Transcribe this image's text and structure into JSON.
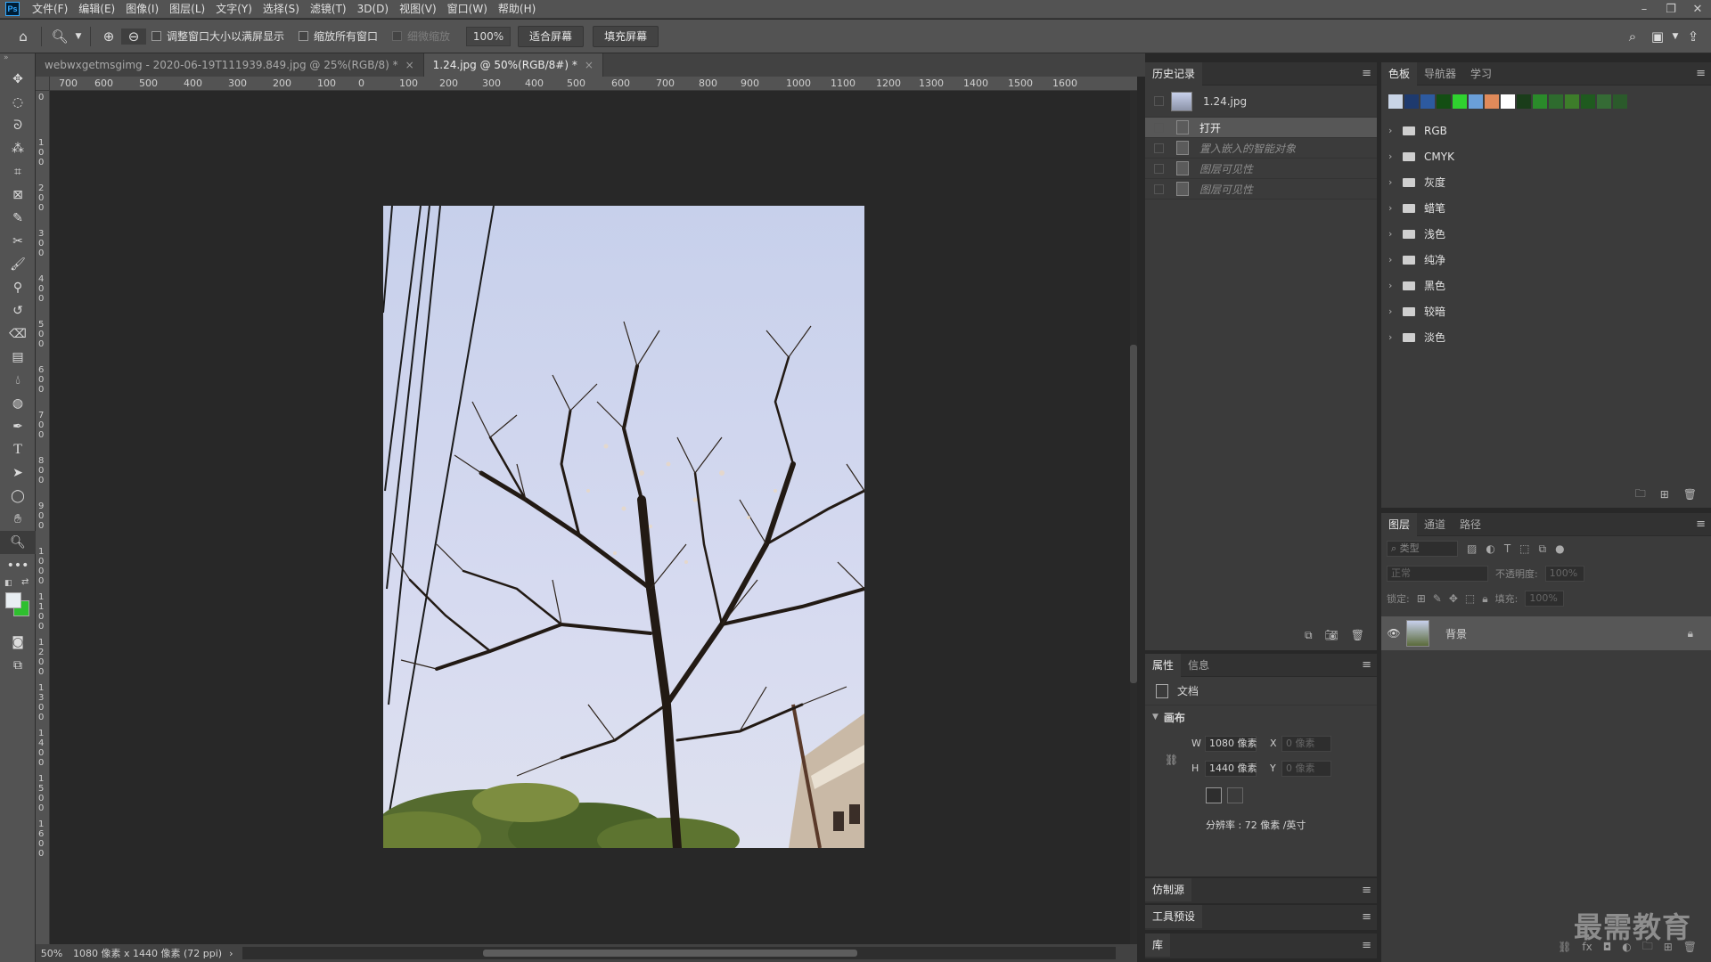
{
  "app": {
    "logo": "Ps",
    "menus": [
      "文件(F)",
      "编辑(E)",
      "图像(I)",
      "图层(L)",
      "文字(Y)",
      "选择(S)",
      "滤镜(T)",
      "3D(D)",
      "视图(V)",
      "窗口(W)",
      "帮助(H)"
    ],
    "window_controls": [
      "minimize-icon",
      "restore-icon",
      "close-icon"
    ]
  },
  "options": {
    "resize_windows_label": "调整窗口大小以满屏显示",
    "zoom_all_label": "缩放所有窗口",
    "scrubby_zoom_label": "细微缩放",
    "zoom_value": "100%",
    "fit_screen_label": "适合屏幕",
    "fill_screen_label": "填充屏幕"
  },
  "tabs": [
    {
      "label": "webwxgetmsgimg - 2020-06-19T111939.849.jpg @ 25%(RGB/8) *",
      "active": false
    },
    {
      "label": "1.24.jpg @ 50%(RGB/8#) *",
      "active": true
    }
  ],
  "ruler": {
    "top": [
      "700",
      "600",
      "500",
      "400",
      "300",
      "200",
      "100",
      "0",
      "100",
      "200",
      "300",
      "400",
      "500",
      "600",
      "700",
      "800",
      "900",
      "1000",
      "1100",
      "1200",
      "1300",
      "1400",
      "1500",
      "1600"
    ],
    "left": [
      "0",
      "1\n0\n0",
      "2\n0\n0",
      "3\n0\n0",
      "4\n0\n0",
      "5\n0\n0",
      "6\n0\n0",
      "7\n0\n0",
      "8\n0\n0",
      "9\n0\n0",
      "1\n0\n0\n0",
      "1\n1\n0\n0",
      "1\n2\n0\n0",
      "1\n3\n0\n0",
      "1\n4\n0\n0",
      "1\n5\n0\n0",
      "1\n6\n0\n0"
    ]
  },
  "status": {
    "zoom": "50%",
    "doc_info": "1080 像素 x 1440 像素 (72 ppi)"
  },
  "history": {
    "tab": "历史记录",
    "snapshot": "1.24.jpg",
    "items": [
      {
        "label": "打开",
        "state": "selected"
      },
      {
        "label": "置入嵌入的智能对象",
        "state": "dim"
      },
      {
        "label": "图层可见性",
        "state": "dim"
      },
      {
        "label": "图层可见性",
        "state": "dim"
      }
    ]
  },
  "properties": {
    "tabs": [
      "属性",
      "信息"
    ],
    "doc_label": "文档",
    "section": "画布",
    "w_label": "W",
    "w_value": "1080 像素",
    "h_label": "H",
    "h_value": "1440 像素",
    "x_label": "X",
    "x_value": "0 像素",
    "y_label": "Y",
    "y_value": "0 像素",
    "resolution": "分辨率 : 72 像素 /英寸"
  },
  "collapsed_panels": [
    "仿制源",
    "工具预设",
    "库"
  ],
  "swatches": {
    "tabs": [
      "色板",
      "导航器",
      "学习"
    ],
    "colors": [
      "#c8d4e6",
      "#1e3a6e",
      "#2d5aa0",
      "#134e13",
      "#2fd22f",
      "#6a9fd8",
      "#e08a5a",
      "#ffffff",
      "#1a3d1a",
      "#2a8a2a",
      "#2e6b2e",
      "#3d7d2a",
      "#1f5a1f",
      "#356b35",
      "#2b5a2b"
    ],
    "folders": [
      "RGB",
      "CMYK",
      "灰度",
      "蜡笔",
      "浅色",
      "纯净",
      "黑色",
      "较暗",
      "淡色"
    ]
  },
  "layers": {
    "tabs": [
      "图层",
      "通道",
      "路径"
    ],
    "filter_placeholder": "类型",
    "blend_mode": "正常",
    "opacity_label": "不透明度:",
    "opacity_value": "100%",
    "lock_label": "锁定:",
    "fill_label": "填充:",
    "fill_value": "100%",
    "layer_name": "背景"
  },
  "watermark": "最需教育",
  "colors": {
    "foreground": "#e8eef2",
    "background": "#2fbf2f",
    "ui_dark": "#282828",
    "ui_panel": "#535353"
  }
}
